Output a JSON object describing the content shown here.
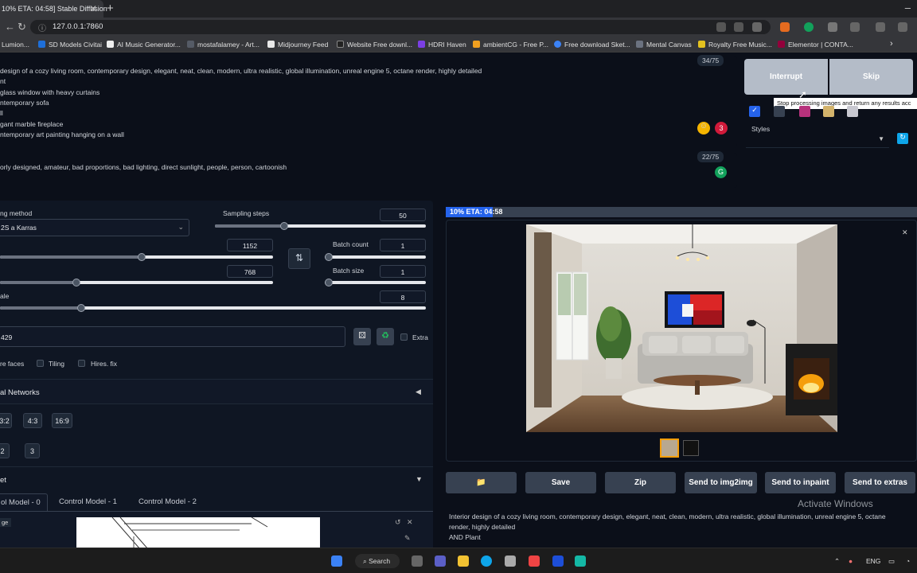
{
  "browser": {
    "tab_title": "10% ETA: 04:58] Stable Diffusion",
    "tab_close": "✕",
    "new_tab": "+",
    "url": "127.0.0.1:7860",
    "bookmarks": [
      {
        "label": "Lumion...",
        "color": "#444a55"
      },
      {
        "label": "SD Models Civitai",
        "color": "#1e6fd9"
      },
      {
        "label": "AI Music Generator...",
        "color": "#eeeeee"
      },
      {
        "label": "mostafalamey - Art...",
        "color": "#555b66"
      },
      {
        "label": "Midjourney Feed",
        "color": "#e8e8e8"
      },
      {
        "label": "Website Free downl...",
        "color": "#222222"
      },
      {
        "label": "HDRI Haven",
        "color": "#7b3fe4"
      },
      {
        "label": "ambientCG - Free P...",
        "color": "#f0a020"
      },
      {
        "label": "Free download Sket...",
        "color": "#3b82f6"
      },
      {
        "label": "Mental Canvas",
        "color": "#6b7280"
      },
      {
        "label": "Royalty Free Music...",
        "color": "#e4c21f"
      },
      {
        "label": "Elementor | CONTA...",
        "color": "#92003b"
      }
    ]
  },
  "prompt": {
    "counter": "34/75",
    "lines": [
      "design of a cozy living room, contemporary design, elegant, neat, clean, modern, ultra realistic, global illumination, unreal engine 5, octane render, highly detailed",
      "nt",
      " glass window with heavy curtains",
      "ntemporary sofa",
      "ll",
      "gant marble fireplace",
      "ntemporary art painting hanging on a wall"
    ],
    "badge_count": "3"
  },
  "negative_prompt": {
    "counter": "22/75",
    "text": "orly designed, amateur, bad proportions, bad lighting, direct sunlight, people, person, cartoonish"
  },
  "controls": {
    "interrupt_label": "Interrupt",
    "skip_label": "Skip",
    "tooltip": "Stop processing images and return any results acc",
    "styles_label": "Styles"
  },
  "params": {
    "sampling_method_label": "ng method",
    "sampling_method_value": "2S a Karras",
    "sampling_steps_label": "Sampling steps",
    "sampling_steps": "50",
    "sampling_steps_fraction": 0.33,
    "width": "1152",
    "width_fraction": 0.52,
    "height": "768",
    "height_fraction": 0.28,
    "batch_count_label": "Batch count",
    "batch_count": "1",
    "batch_size_label": "Batch size",
    "batch_size": "1",
    "cfg_label": "ale",
    "cfg_value": "8",
    "cfg_fraction": 0.19,
    "seed_value": "429",
    "extra_label": "Extra",
    "restore_faces_label": "re faces",
    "tiling_label": "Tiling",
    "hires_label": "Hires. fix",
    "swap_icon": "⇅"
  },
  "sections": {
    "networks_label": "al Networks",
    "ratios": [
      "3:2",
      "4:3",
      "16:9"
    ],
    "nums": [
      "2",
      "3"
    ],
    "controlnet_label": "et",
    "control_tabs": [
      "ol Model - 0",
      "Control Model - 1",
      "Control Model - 2"
    ],
    "image_label": "ge"
  },
  "output": {
    "progress_text": "10% ETA: 04:58",
    "progress_fraction": 0.1,
    "buttons": [
      "Save",
      "Zip",
      "Send to img2img",
      "Send to inpaint",
      "Send to extras"
    ],
    "folder_icon": "📁",
    "info_text_1": "Interior design of a cozy living room, contemporary design, elegant, neat, clean, modern, ultra realistic, global illumination, unreal engine 5, octane",
    "info_text_2": "render, highly detailed",
    "info_text_3": "AND Plant",
    "watermark": "Activate Windows"
  },
  "taskbar": {
    "search_label": "Search",
    "lang": "ENG"
  }
}
